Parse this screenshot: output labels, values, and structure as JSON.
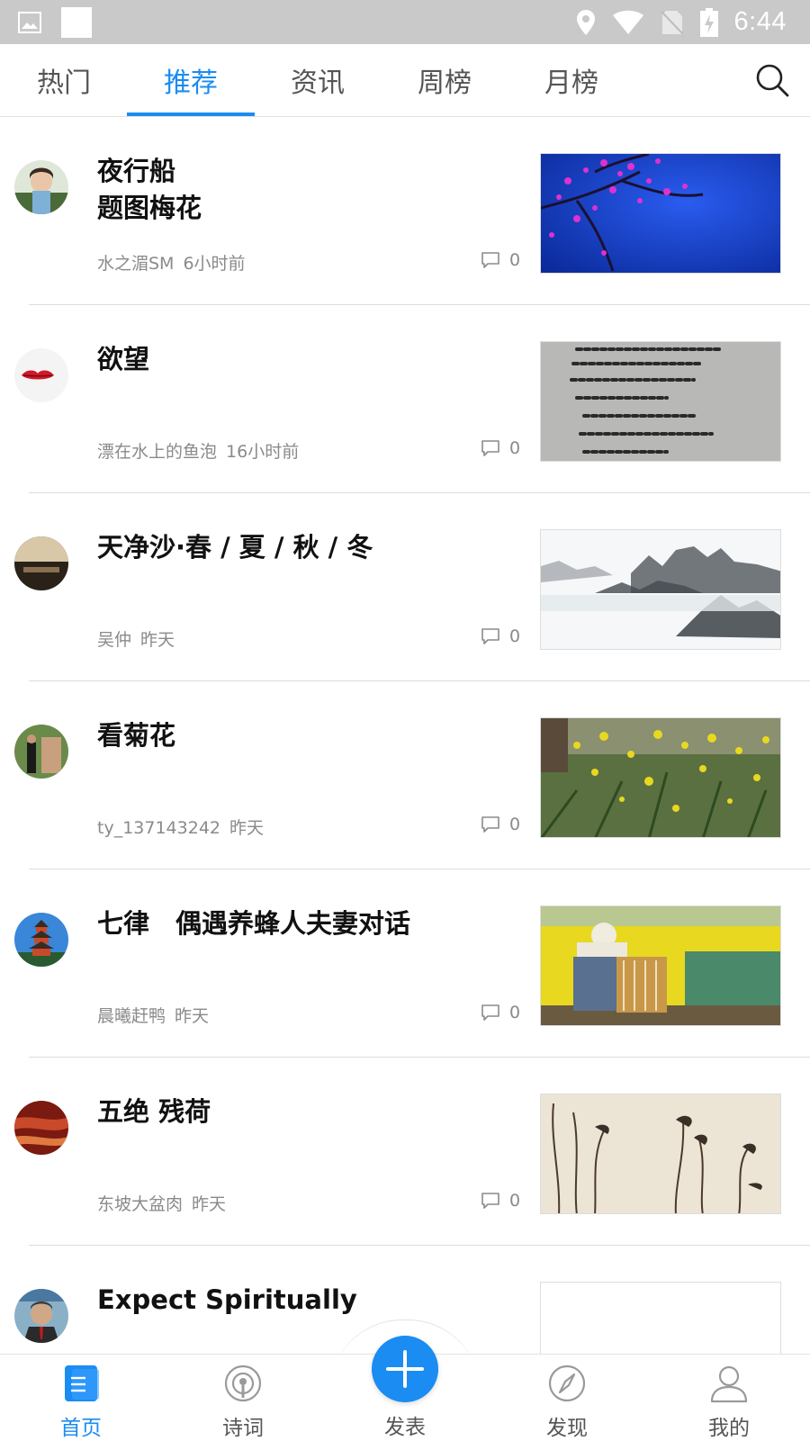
{
  "status_bar": {
    "time": "6:44"
  },
  "tabs": [
    {
      "label": "热门"
    },
    {
      "label": "推荐"
    },
    {
      "label": "资讯"
    },
    {
      "label": "周榜"
    },
    {
      "label": "月榜"
    }
  ],
  "active_tab": "推荐",
  "colors": {
    "accent": "#1a8cf2",
    "meta_text": "#8a8a8a",
    "status_bar": "#c9c9c9"
  },
  "feed": [
    {
      "title": "夜行船\n题图梅花",
      "author": "水之湄SM",
      "time": "6小时前",
      "comments": "0"
    },
    {
      "title": "欲望",
      "author": "漂在水上的鱼泡",
      "time": "16小时前",
      "comments": "0"
    },
    {
      "title": "天净沙·春 / 夏 / 秋 / 冬",
      "author": "吴仲",
      "time": "昨天",
      "comments": "0"
    },
    {
      "title": "看菊花",
      "author": "ty_137143242",
      "time": "昨天",
      "comments": "0"
    },
    {
      "title": "七律　偶遇养蜂人夫妻对话",
      "author": "晨曦赶鸭",
      "time": "昨天",
      "comments": "0"
    },
    {
      "title": "五绝  残荷",
      "author": "东坡大盆肉",
      "time": "昨天",
      "comments": "0"
    },
    {
      "title": "Expect Spiritually",
      "author": "",
      "time": "",
      "comments": ""
    }
  ],
  "bottom_nav": {
    "home": "首页",
    "poems": "诗词",
    "publish": "发表",
    "discover": "发现",
    "mine": "我的"
  },
  "icons": {
    "search": "search-icon",
    "comment": "comment-icon",
    "home": "home-icon",
    "poems": "podcast-icon",
    "publish": "plus-icon",
    "discover": "compass-icon",
    "mine": "user-icon"
  }
}
